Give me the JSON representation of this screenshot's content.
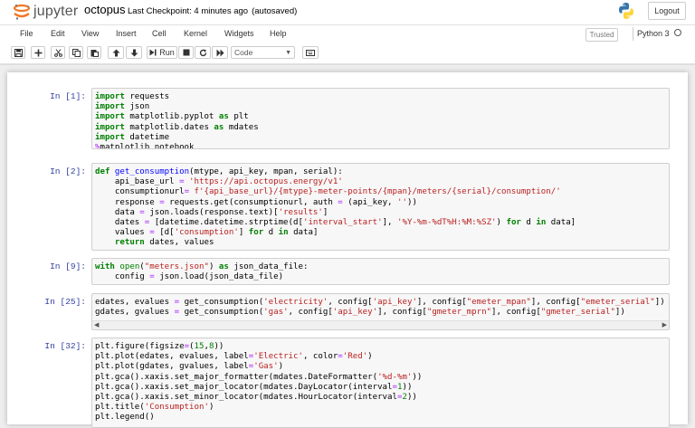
{
  "header": {
    "logo_text": "jupyter",
    "notebook_name": "octopus",
    "checkpoint": "Last Checkpoint: 4 minutes ago",
    "autosave_status": "(autosaved)",
    "logout_label": "Logout"
  },
  "menu": {
    "items": [
      "File",
      "Edit",
      "View",
      "Insert",
      "Cell",
      "Kernel",
      "Widgets",
      "Help"
    ],
    "trusted_label": "Trusted",
    "kernel_name": "Python 3"
  },
  "toolbar": {
    "run_label": "Run",
    "cell_type": "Code"
  },
  "cells": [
    {
      "prompt": "In [1]:",
      "lines": [
        "import requests",
        "import json",
        "import matplotlib.pyplot as plt",
        "import matplotlib.dates as mdates",
        "import datetime",
        "%matplotlib notebook"
      ]
    },
    {
      "prompt": "In [2]:",
      "lines": [
        "def get_consumption(mtype, api_key, mpan, serial):",
        "    api_base_url = 'https://api.octopus.energy/v1'",
        "    consumptionurl= f'{api_base_url}/{mtype}-meter-points/{mpan}/meters/{serial}/consumption/'",
        "    response = requests.get(consumptionurl, auth = (api_key, ''))",
        "    data = json.loads(response.text)['results']",
        "    dates = [datetime.datetime.strptime(d['interval_start'], '%Y-%m-%dT%H:%M:%SZ') for d in data]",
        "    values = [d['consumption'] for d in data]",
        "    return dates, values"
      ]
    },
    {
      "prompt": "In [9]:",
      "lines": [
        "with open(\"meters.json\") as json_data_file:",
        "    config = json.load(json_data_file)"
      ]
    },
    {
      "prompt": "In [25]:",
      "lines": [
        "edates, evalues = get_consumption('electricity', config['api_key'], config[\"emeter_mpan\"], config[\"emeter_serial\"])",
        "gdates, gvalues = get_consumption('gas', config['api_key'], config[\"gmeter_mprn\"], config[\"gmeter_serial\"])"
      ]
    },
    {
      "prompt": "In [32]:",
      "lines": [
        "plt.figure(figsize=(15,8))",
        "plt.plot(edates, evalues, label='Electric', color='Red')",
        "plt.plot(gdates, gvalues, label='Gas')",
        "plt.gca().xaxis.set_major_formatter(mdates.DateFormatter('%d-%m'))",
        "plt.gca().xaxis.set_major_locator(mdates.DayLocator(interval=1))",
        "plt.gca().xaxis.set_minor_locator(mdates.HourLocator(interval=2))",
        "plt.title('Consumption')",
        "plt.legend()"
      ]
    }
  ],
  "colors": {
    "prompt": "#303f9f",
    "keyword": "#008000",
    "operator": "#aa22ff",
    "string": "#ba2121",
    "function": "#0000ff"
  }
}
